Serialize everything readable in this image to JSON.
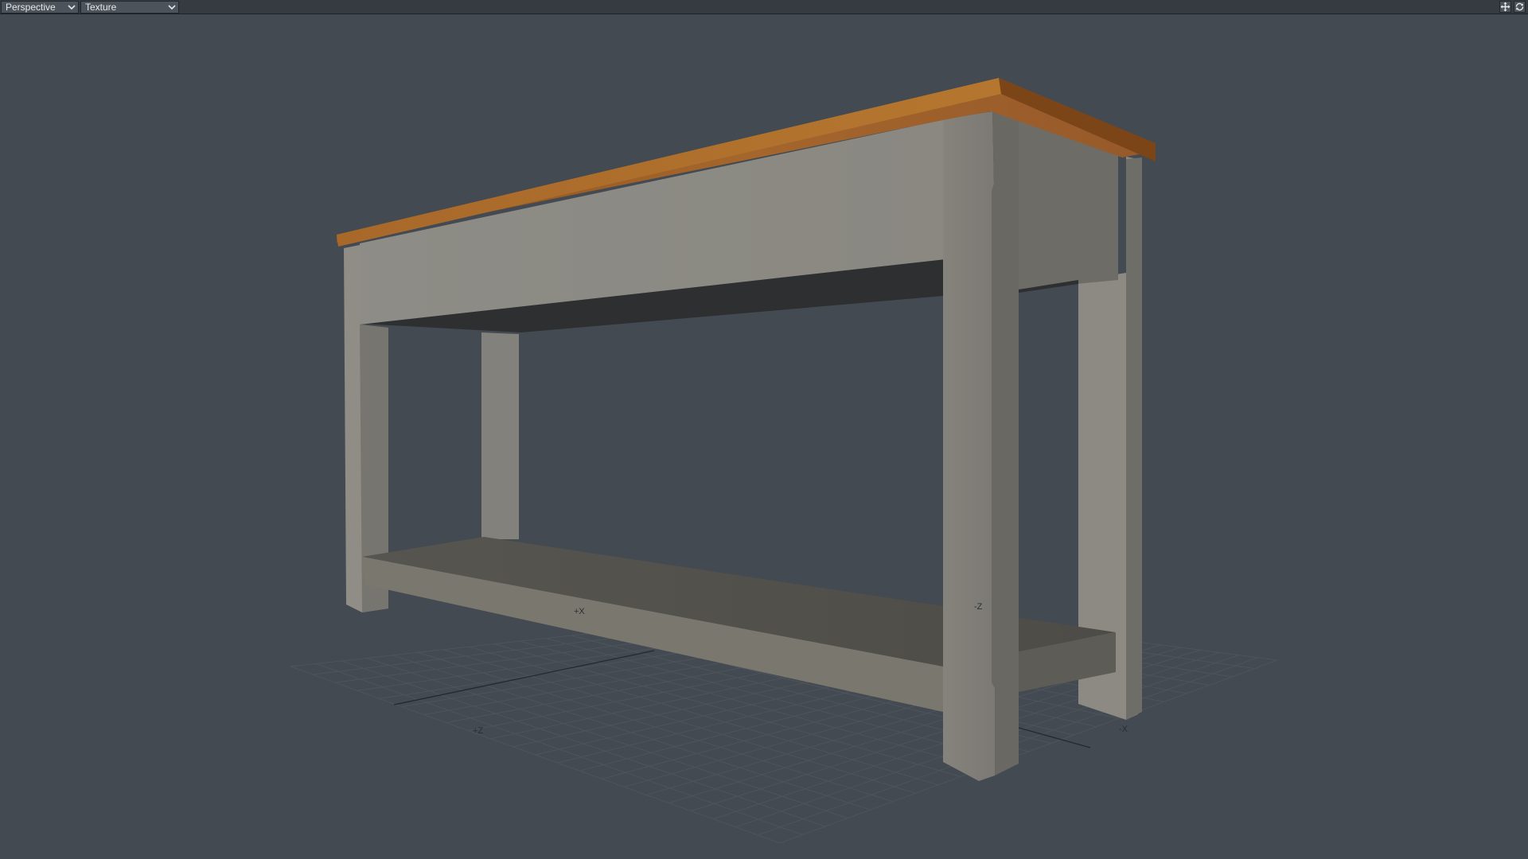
{
  "toolbar": {
    "view_mode": "Perspective",
    "render_mode": "Texture",
    "icons": [
      "move-view-icon",
      "rotate-view-icon"
    ]
  },
  "viewport": {
    "axis_labels": {
      "pos_x": "+X",
      "neg_z": "-Z",
      "pos_z": "+Z",
      "neg_x": "-X"
    }
  },
  "colors": {
    "background": "#434a51",
    "toolbar": "#353b41",
    "table_paint": "#8a8880",
    "table_top_wood": "#a8652a",
    "grid": "#4b5157"
  }
}
